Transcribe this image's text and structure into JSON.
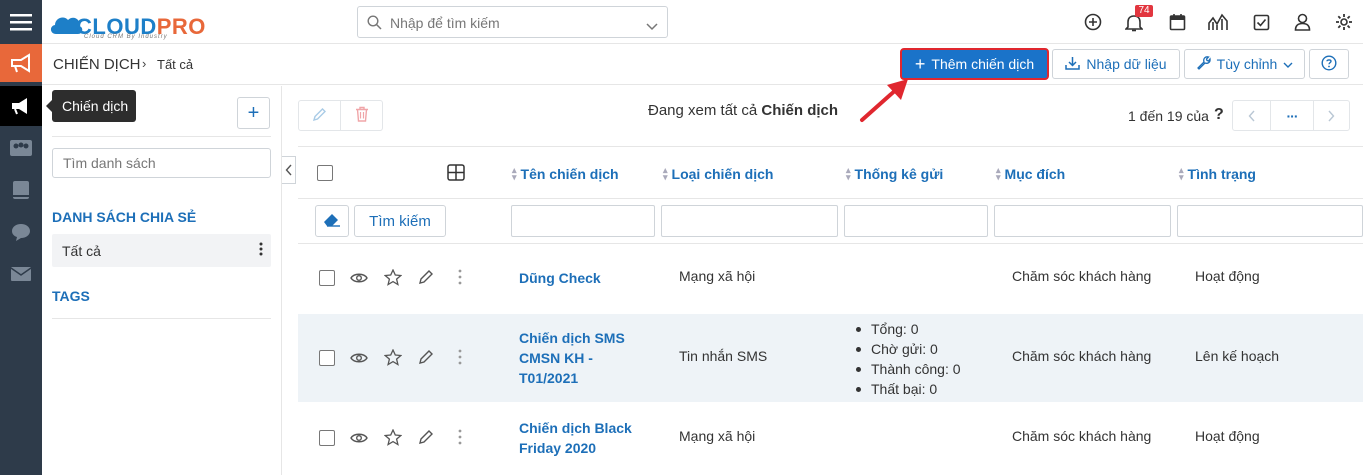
{
  "app": {
    "logo_main": "CLOUD",
    "logo_accent": "PRO",
    "logo_tagline": "Cloud CRM By Industry",
    "notification_count": "74"
  },
  "search": {
    "placeholder": "Nhập để tìm kiếm"
  },
  "breadcrumb": {
    "module": "CHIẾN DỊCH",
    "separator": "›",
    "current": "Tất cả"
  },
  "actions": {
    "add_label": "Thêm chiến dịch",
    "import_label": "Nhập dữ liệu",
    "customize_label": "Tùy chỉnh"
  },
  "tooltip": {
    "text": "Chiến dịch"
  },
  "sidebar": {
    "search_placeholder": "Tìm danh sách",
    "shared_heading": "DANH SÁCH CHIA SẺ",
    "shared_item": "Tất cả",
    "tags_heading": "TAGS"
  },
  "list": {
    "viewing_prefix": "Đang xem tất cả ",
    "viewing_module": "Chiến dịch",
    "pager_text": "1 đến 19 của",
    "pager_q": "?",
    "pager_more": "···",
    "search_button": "Tìm kiếm",
    "columns": [
      "Tên chiến dịch",
      "Loại chiến dịch",
      "Thống kê gửi",
      "Mục đích",
      "Tình trạng"
    ],
    "rows": [
      {
        "name": "Dũng Check",
        "type": "Mạng xã hội",
        "stats": [],
        "purpose": "Chăm sóc khách hàng",
        "status": "Hoạt động"
      },
      {
        "name": "Chiến dịch SMS CMSN KH - T01/2021",
        "type": "Tin nhắn SMS",
        "stats": [
          "Tổng: 0",
          "Chờ gửi: 0",
          "Thành công: 0",
          "Thất bại: 0"
        ],
        "purpose": "Chăm sóc khách hàng",
        "status": "Lên kế hoạch"
      },
      {
        "name": "Chiến dịch Black Friday 2020",
        "type": "Mạng xã hội",
        "stats": [],
        "purpose": "Chăm sóc khách hàng",
        "status": "Hoạt động"
      }
    ]
  },
  "colors": {
    "primary": "#1a73c9",
    "accent": "#e8683a",
    "rail": "#2e3b4a",
    "highlight_border": "#e0272f"
  },
  "icons": [
    "menu-icon",
    "megaphone-icon",
    "users-icon",
    "book-icon",
    "chat-icon",
    "mail-icon",
    "plus-circle-icon",
    "bell-icon",
    "calendar-icon",
    "chart-icon",
    "checkbox-icon",
    "user-icon",
    "gear-icon",
    "search-icon",
    "chevron-down-icon",
    "upload-icon",
    "wrench-icon",
    "help-icon",
    "pencil-icon",
    "trash-icon",
    "grid-icon",
    "eraser-icon",
    "eye-icon",
    "star-icon",
    "kebab-icon"
  ]
}
